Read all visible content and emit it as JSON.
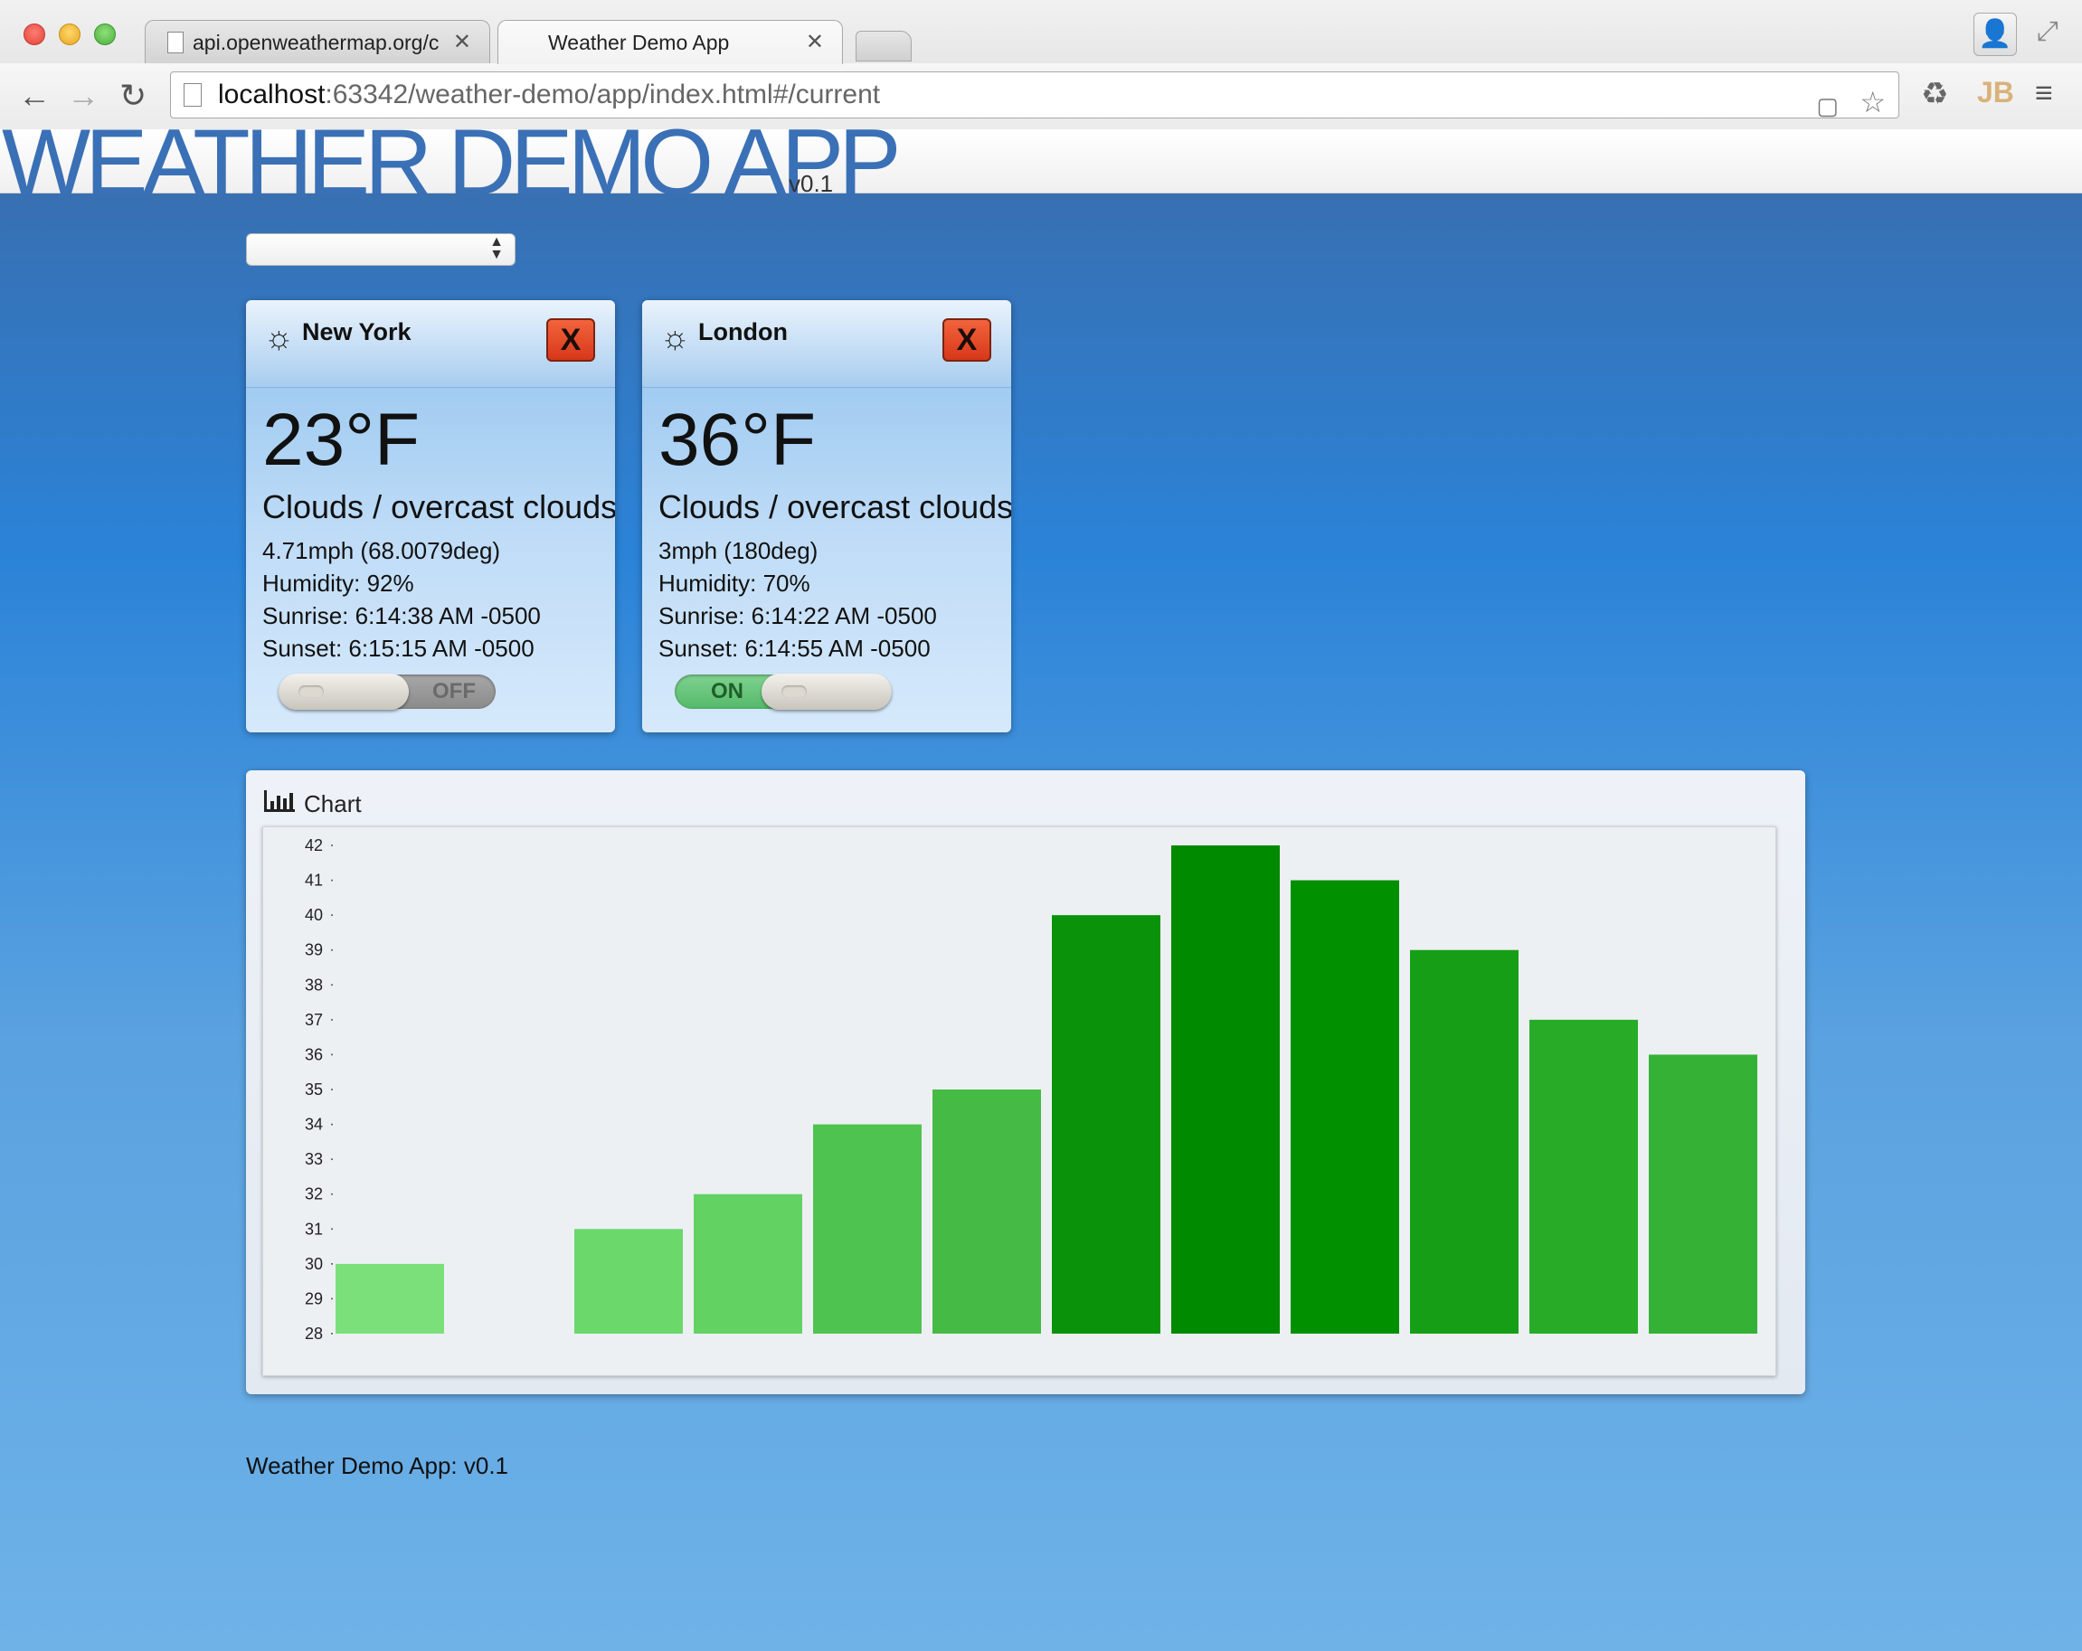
{
  "browser": {
    "tabs": [
      {
        "title": "api.openweathermap.org/c"
      },
      {
        "title": "Weather Demo App"
      }
    ],
    "url_host": "localhost",
    "url_path": ":63342/weather-demo/app/index.html#/current"
  },
  "app": {
    "title": "WEATHER DEMO APP",
    "version": "v0.1",
    "city_select_value": ""
  },
  "cities": [
    {
      "name": "New York",
      "remove_label": "X",
      "temp": "23°F",
      "condition": "Clouds / overcast clouds",
      "wind": "4.71mph (68.0079deg)",
      "humidity": "Humidity: 92%",
      "sunrise": "Sunrise: 6:14:38 AM -0500",
      "sunset": "Sunset: 6:15:15 AM -0500",
      "toggle_state": "OFF"
    },
    {
      "name": "London",
      "remove_label": "X",
      "temp": "36°F",
      "condition": "Clouds / overcast clouds",
      "wind": "3mph (180deg)",
      "humidity": "Humidity: 70%",
      "sunrise": "Sunrise: 6:14:22 AM -0500",
      "sunset": "Sunset: 6:14:55 AM -0500",
      "toggle_state": "ON"
    }
  ],
  "chart_panel": {
    "label": "Chart"
  },
  "chart_data": {
    "type": "bar",
    "values": [
      30,
      28,
      31,
      32,
      34,
      35,
      40,
      42,
      41,
      39,
      37,
      36
    ],
    "ylim": [
      28,
      42
    ],
    "yticks": [
      28,
      29,
      30,
      31,
      32,
      33,
      34,
      35,
      36,
      37,
      38,
      39,
      40,
      41,
      42
    ],
    "colors": [
      "#7be07a",
      "#7be07a",
      "#6ad86b",
      "#62d262",
      "#4fc34f",
      "#45bb45",
      "#0a930a",
      "#008a00",
      "#009000",
      "#169f16",
      "#28ac28",
      "#35b235"
    ]
  },
  "footer": {
    "text": "Weather Demo App: v0.1"
  }
}
